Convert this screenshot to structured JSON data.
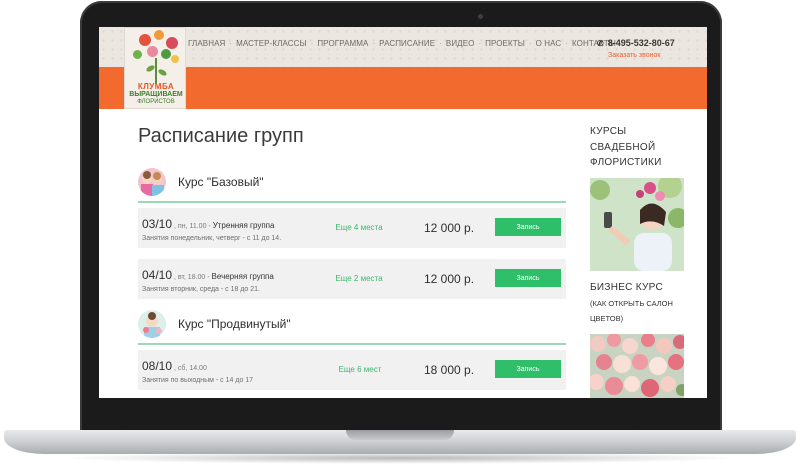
{
  "site": {
    "logo": {
      "line1": "КЛУМБА",
      "line2": "ВЫРАЩИВАЕМ",
      "line3": "ФЛОРИСТОВ"
    },
    "nav": [
      "ГЛАВНАЯ",
      "МАСТЕР-КЛАССЫ",
      "ПРОГРАММА",
      "РАСПИСАНИЕ",
      "ВИДЕО",
      "ПРОЕКТЫ",
      "О НАС",
      "КОНТАКТЫ"
    ],
    "nav_separator": "·",
    "phone": "8-495-532-80-67",
    "callback_label": "Заказать звонок"
  },
  "page": {
    "title": "Расписание групп"
  },
  "courses": [
    {
      "title": "Курс \"Базовый\"",
      "sessions": [
        {
          "date": "03/10",
          "day_time": ", пн, 11.00 - ",
          "group": "Утренняя группа",
          "details": "Занятия понедельник, четверг - с 11 до 14.",
          "seats": "Еще 4 места",
          "price": "12 000 р.",
          "button": "Запись"
        },
        {
          "date": "04/10",
          "day_time": ", вт, 18.00 - ",
          "group": "Вечерняя группа",
          "details": "Занятия вторник, среда - с 18 до 21.",
          "seats": "Еще 2 места",
          "price": "12 000 р.",
          "button": "Запись"
        }
      ]
    },
    {
      "title": "Курс \"Продвинутый\"",
      "sessions": [
        {
          "date": "08/10",
          "day_time": ", сб, 14.00",
          "group": "",
          "details": "Занятия по выходным - с 14 до 17",
          "seats": "Еще 6 мест",
          "price": "18 000 р.",
          "button": "Запись"
        }
      ]
    }
  ],
  "sidebar": {
    "promo1": {
      "title": "КУРСЫ СВАДЕБНОЙ ФЛОРИСТИКИ"
    },
    "promo2": {
      "title": "БИЗНЕС КУРС",
      "subtitle": "(КАК ОТКРЫТЬ САЛОН ЦВЕТОВ)"
    }
  },
  "colors": {
    "accent": "#f36a2e",
    "green": "#2fbf6a",
    "seats_text": "#3fb56e",
    "divider": "#9ad8b6",
    "header_bg": "#ebe6df"
  },
  "icons": [
    "phone-icon"
  ]
}
